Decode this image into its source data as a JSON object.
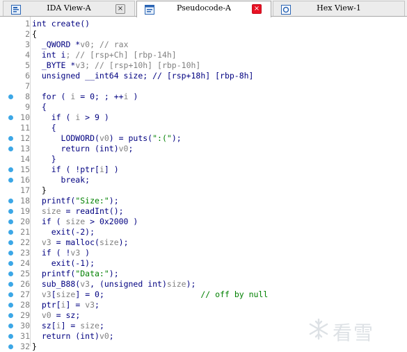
{
  "tabs": [
    {
      "label": "IDA View-A",
      "icon": "ida-view-icon",
      "close": "×",
      "active": false
    },
    {
      "label": "Pseudocode-A",
      "icon": "pseudocode-icon",
      "close": "×",
      "active": true
    },
    {
      "label": "Hex View-1",
      "icon": "hex-view-icon",
      "close": "×",
      "active": false
    }
  ],
  "lines": [
    {
      "n": "1",
      "bp": false,
      "tokens": [
        [
          "int create()",
          "kw"
        ]
      ]
    },
    {
      "n": "2",
      "bp": false,
      "tokens": [
        [
          "{",
          "p"
        ]
      ]
    },
    {
      "n": "3",
      "bp": false,
      "tokens": [
        [
          "  _QWORD *",
          "kw"
        ],
        [
          "v0",
          "v"
        ],
        [
          "; // rax",
          "v"
        ]
      ]
    },
    {
      "n": "4",
      "bp": false,
      "tokens": [
        [
          "  int ",
          "kw"
        ],
        [
          "i",
          "kw"
        ],
        [
          "; // [rsp+Ch] [rbp-14h]",
          "v"
        ]
      ]
    },
    {
      "n": "5",
      "bp": false,
      "tokens": [
        [
          "  _BYTE *",
          "kw"
        ],
        [
          "v3",
          "v"
        ],
        [
          "; // [rsp+10h] [rbp-10h]",
          "v"
        ]
      ]
    },
    {
      "n": "6",
      "bp": false,
      "tokens": [
        [
          "  unsigned __int64 size; // [rsp+18h] [rbp-8h]",
          "kw"
        ]
      ]
    },
    {
      "n": "7",
      "bp": false,
      "tokens": [
        [
          "",
          "p"
        ]
      ]
    },
    {
      "n": "8",
      "bp": true,
      "tokens": [
        [
          "  for ( ",
          "kw"
        ],
        [
          "i",
          "v"
        ],
        [
          " = 0; ; ++",
          "kw"
        ],
        [
          "i",
          "v"
        ],
        [
          " )",
          "kw"
        ]
      ]
    },
    {
      "n": "9",
      "bp": false,
      "tokens": [
        [
          "  {",
          "kw"
        ]
      ]
    },
    {
      "n": "10",
      "bp": true,
      "tokens": [
        [
          "    if ( ",
          "kw"
        ],
        [
          "i",
          "v"
        ],
        [
          " > 9 )",
          "kw"
        ]
      ]
    },
    {
      "n": "11",
      "bp": false,
      "tokens": [
        [
          "    {",
          "kw"
        ]
      ]
    },
    {
      "n": "12",
      "bp": true,
      "tokens": [
        [
          "      LODWORD(",
          "kw"
        ],
        [
          "v0",
          "v"
        ],
        [
          ") = puts(\":(\");",
          "kw"
        ]
      ]
    },
    {
      "n": "13",
      "bp": true,
      "tokens": [
        [
          "      return (int)",
          "kw"
        ],
        [
          "v0",
          "v"
        ],
        [
          ";",
          "kw"
        ]
      ]
    },
    {
      "n": "14",
      "bp": false,
      "tokens": [
        [
          "    }",
          "kw"
        ]
      ]
    },
    {
      "n": "15",
      "bp": true,
      "tokens": [
        [
          "    if ( !ptr[",
          "kw"
        ],
        [
          "i",
          "v"
        ],
        [
          "] )",
          "kw"
        ]
      ]
    },
    {
      "n": "16",
      "bp": true,
      "tokens": [
        [
          "      break;",
          "kw"
        ]
      ]
    },
    {
      "n": "17",
      "bp": false,
      "tokens": [
        [
          "  }",
          "p"
        ]
      ]
    },
    {
      "n": "18",
      "bp": true,
      "tokens": [
        [
          "  printf(\"Size:\");",
          "kw"
        ]
      ]
    },
    {
      "n": "19",
      "bp": true,
      "tokens": [
        [
          "  ",
          "kw"
        ],
        [
          "size",
          "v"
        ],
        [
          " = readInt();",
          "kw"
        ]
      ]
    },
    {
      "n": "20",
      "bp": true,
      "tokens": [
        [
          "  if ( ",
          "kw"
        ],
        [
          "size",
          "v"
        ],
        [
          " > 0x2000 )",
          "kw"
        ]
      ]
    },
    {
      "n": "21",
      "bp": true,
      "tokens": [
        [
          "    exit(-2);",
          "kw"
        ]
      ]
    },
    {
      "n": "22",
      "bp": true,
      "tokens": [
        [
          "  ",
          "kw"
        ],
        [
          "v3",
          "v"
        ],
        [
          " = malloc(",
          "kw"
        ],
        [
          "size",
          "v"
        ],
        [
          ");",
          "kw"
        ]
      ]
    },
    {
      "n": "23",
      "bp": true,
      "tokens": [
        [
          "  if ( !",
          "kw"
        ],
        [
          "v3",
          "v"
        ],
        [
          " )",
          "kw"
        ]
      ]
    },
    {
      "n": "24",
      "bp": true,
      "tokens": [
        [
          "    exit(-1);",
          "kw"
        ]
      ]
    },
    {
      "n": "25",
      "bp": true,
      "tokens": [
        [
          "  printf(\"Data:\");",
          "kw"
        ]
      ]
    },
    {
      "n": "26",
      "bp": true,
      "tokens": [
        [
          "  sub_B88(",
          "kw"
        ],
        [
          "v3",
          "v"
        ],
        [
          ", (unsigned int)",
          "kw"
        ],
        [
          "size",
          "v"
        ],
        [
          ");",
          "kw"
        ]
      ]
    },
    {
      "n": "27",
      "bp": true,
      "tokens": [
        [
          "  ",
          "kw"
        ],
        [
          "v3",
          "v"
        ],
        [
          "[",
          "kw"
        ],
        [
          "size",
          "v"
        ],
        [
          "] = 0;",
          "kw"
        ],
        [
          "                    // off by null",
          "c"
        ]
      ]
    },
    {
      "n": "28",
      "bp": true,
      "tokens": [
        [
          "  ptr[",
          "kw"
        ],
        [
          "i",
          "v"
        ],
        [
          "] = ",
          "kw"
        ],
        [
          "v3",
          "v"
        ],
        [
          ";",
          "kw"
        ]
      ]
    },
    {
      "n": "29",
      "bp": true,
      "tokens": [
        [
          "  ",
          "kw"
        ],
        [
          "v0",
          "v"
        ],
        [
          " = sz;",
          "kw"
        ]
      ]
    },
    {
      "n": "30",
      "bp": true,
      "tokens": [
        [
          "  sz[",
          "kw"
        ],
        [
          "i",
          "v"
        ],
        [
          "] = ",
          "kw"
        ],
        [
          "size",
          "v"
        ],
        [
          ";",
          "kw"
        ]
      ]
    },
    {
      "n": "31",
      "bp": true,
      "tokens": [
        [
          "  return (int)",
          "kw"
        ],
        [
          "v0",
          "v"
        ],
        [
          ";",
          "kw"
        ]
      ]
    },
    {
      "n": "32",
      "bp": true,
      "tokens": [
        [
          "}",
          "p"
        ]
      ]
    }
  ],
  "watermark": {
    "text": "看雪",
    "icon": "snowflake-logo-icon"
  },
  "colors": {
    "keyword": "#000080",
    "variable": "#808080",
    "string_comment": "#008000",
    "breakpoint": "#3ca7e6",
    "active_close": "#e81123"
  }
}
